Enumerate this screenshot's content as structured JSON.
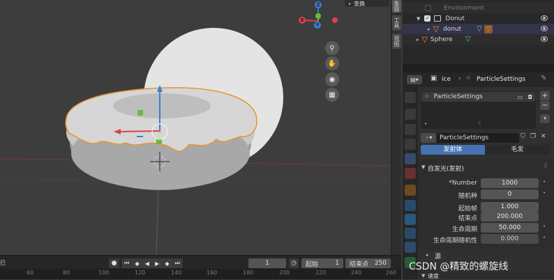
{
  "viewport": {
    "transform_panel_label": "变换",
    "gizmo_axes": {
      "z": "Z",
      "x": "X",
      "y": "Y"
    },
    "nav_buttons": [
      "zoom-icon",
      "hand-icon",
      "camera-icon",
      "grid-icon"
    ]
  },
  "side_tabs": [
    "条目",
    "工具",
    "视图"
  ],
  "outliner": {
    "rows": [
      {
        "label": "Environment"
      },
      {
        "label": "Donut"
      },
      {
        "label": "donut"
      },
      {
        "label": "Sphere"
      }
    ]
  },
  "properties": {
    "breadcrumb_object": "ice",
    "breadcrumb_settings": "ParticleSettings",
    "slot_name": "ParticleSettings",
    "datablock_name": "ParticleSettings",
    "type_tabs": {
      "emitter": "发射体",
      "hair": "毛发"
    },
    "emission_panel_title": "自发光(发射)",
    "fields": [
      {
        "label": "*Number",
        "value": "1000"
      },
      {
        "label": "随机种",
        "value": "0"
      },
      {
        "label": "起始帧",
        "value": "1.000"
      },
      {
        "label": "结束点",
        "value": "200.000"
      },
      {
        "label": "生命周期",
        "value": "50.000"
      },
      {
        "label": "生命周期随机性",
        "value": "0.000"
      }
    ],
    "source_panel_title": "源",
    "cut_panel_title": "速度"
  },
  "timeline": {
    "current_frame": "1",
    "start_label": "起始",
    "start_value": "1",
    "end_label": "结束点",
    "end_value": "250",
    "ruler_ticks": [
      "60",
      "80",
      "100",
      "120",
      "140",
      "160",
      "180",
      "200",
      "220",
      "240",
      "260"
    ],
    "left_label": "已"
  },
  "watermark": "CSDN @精致的螺旋线",
  "colors": {
    "accent_blue": "#4772b3",
    "selection_orange": "#e8942a",
    "axis_x": "#d9424a",
    "axis_y": "#6fb83a",
    "axis_z": "#3b7fd1"
  }
}
